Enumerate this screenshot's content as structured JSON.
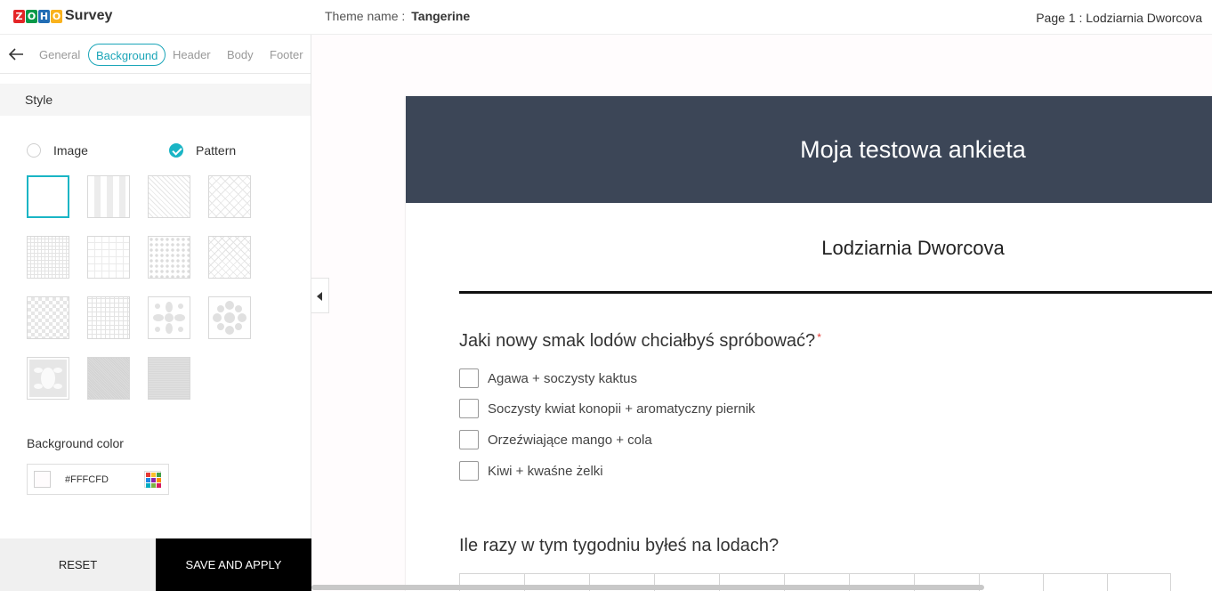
{
  "app": {
    "logo_letters": [
      "Z",
      "O",
      "H",
      "O"
    ],
    "logo_colors": [
      "#e42527",
      "#089949",
      "#226db4",
      "#f9b21d"
    ],
    "product_name": "Survey"
  },
  "header": {
    "theme_label": "Theme name :",
    "theme_value": "Tangerine",
    "page_label": "Page 1 : Lodziarnia Dworcova"
  },
  "panel": {
    "tabs": [
      {
        "label": "General",
        "active": false
      },
      {
        "label": "Background",
        "active": true
      },
      {
        "label": "Header",
        "active": false
      },
      {
        "label": "Body",
        "active": false
      },
      {
        "label": "Footer",
        "active": false
      }
    ],
    "style_heading": "Style",
    "options": [
      {
        "label": "Image",
        "checked": false
      },
      {
        "label": "Pattern",
        "checked": true
      }
    ],
    "patterns": [
      "none",
      "vertical-stripes",
      "diagonal-lines",
      "diamond-lattice",
      "fine-grid",
      "plus-grid",
      "dots",
      "basket-weave",
      "checker",
      "small-squares",
      "floral-tile",
      "flower-tile",
      "damask",
      "dense-texture",
      "linen-texture"
    ],
    "selected_pattern": "none",
    "bg_color_label": "Background color",
    "bg_color_value": "#FFFCFD",
    "reset_label": "RESET",
    "save_label": "SAVE AND APPLY"
  },
  "preview": {
    "form_title": "Moja testowa ankieta",
    "page_name": "Lodziarnia Dworcova",
    "q1": {
      "text": "Jaki nowy smak lodów chciałbyś spróbować?",
      "required_mark": "*",
      "options": [
        "Agawa + soczysty kaktus",
        "Soczysty kwiat konopii + aromatyczny piernik",
        "Orzeźwiające mango + cola",
        "Kiwi + kwaśne żelki"
      ]
    },
    "q2": {
      "text": "Ile razy w tym tygodniu byłeś na lodach?"
    },
    "colors": {
      "header_bg": "#3c4657",
      "accent": "#1ab5c5",
      "canvas_bg": "#FFFCFD"
    }
  }
}
